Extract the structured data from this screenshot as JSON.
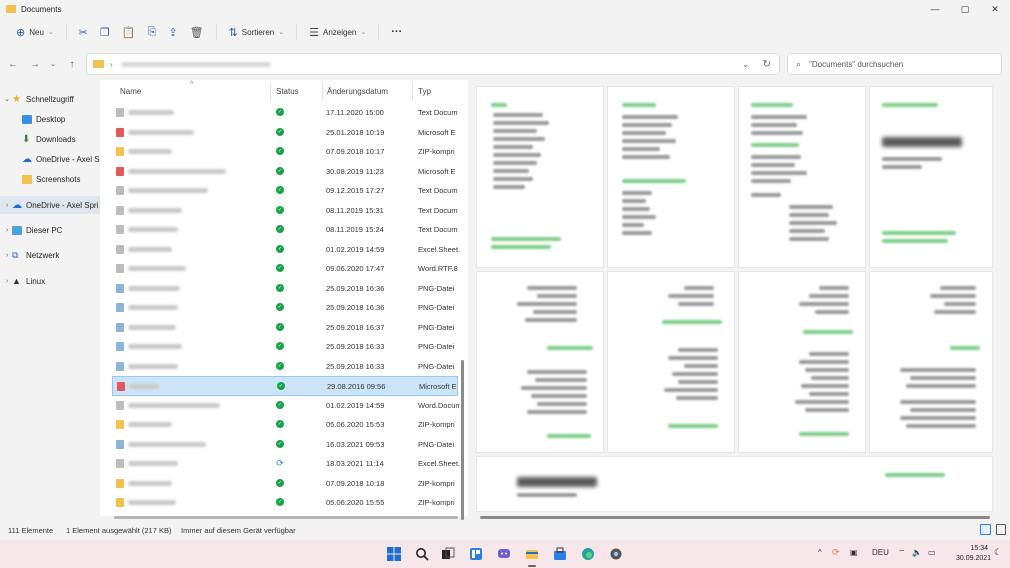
{
  "window": {
    "title": "Documents",
    "controls": {
      "minimize": "—",
      "maximize": "▢",
      "close": "✕"
    }
  },
  "toolbar": {
    "new_label": "Neu",
    "sort_label": "Sortieren",
    "view_label": "Anzeigen",
    "more_label": "···"
  },
  "address": {
    "search_placeholder": "\"Documents\" durchsuchen"
  },
  "nav": {
    "items": [
      {
        "label": "Schnellzugriff",
        "icon": "star-icon"
      },
      {
        "label": "Desktop",
        "icon": "desktop-icon"
      },
      {
        "label": "Downloads",
        "icon": "download-icon"
      },
      {
        "label": "OneDrive - Axel Sp",
        "icon": "onedrive-icon"
      },
      {
        "label": "Screenshots",
        "icon": "folder-icon"
      },
      {
        "label": "OneDrive - Axel Spri",
        "icon": "cloud-icon"
      },
      {
        "label": "Dieser PC",
        "icon": "pc-icon"
      },
      {
        "label": "Netzwerk",
        "icon": "network-icon"
      },
      {
        "label": "Linux",
        "icon": "linux-icon"
      }
    ]
  },
  "columns": {
    "name": "Name",
    "status": "Status",
    "date": "Änderungsdatum",
    "type": "Typ"
  },
  "files": [
    {
      "date": "17.11.2020 15:00",
      "type": "Text Docum",
      "status": "ok",
      "color": "#bdbdbd"
    },
    {
      "date": "25.01.2018 10:19",
      "type": "Microsoft E",
      "status": "ok",
      "color": "#e05a5a"
    },
    {
      "date": "07.09.2018 10:17",
      "type": "ZIP-kompri",
      "status": "ok",
      "color": "#f2c14e"
    },
    {
      "date": "30.08.2019 11:23",
      "type": "Microsoft E",
      "status": "ok",
      "color": "#e05a5a"
    },
    {
      "date": "09.12.2015 17:27",
      "type": "Text Docum",
      "status": "ok",
      "color": "#bdbdbd"
    },
    {
      "date": "08.11.2019 15:31",
      "type": "Text Docum",
      "status": "ok",
      "color": "#bdbdbd"
    },
    {
      "date": "08.11.2019 15:24",
      "type": "Text Docum",
      "status": "ok",
      "color": "#bdbdbd"
    },
    {
      "date": "01.02.2019 14:59",
      "type": "Excel.Sheet.",
      "status": "ok",
      "color": "#bdbdbd"
    },
    {
      "date": "09.06.2020 17:47",
      "type": "Word.RTF.8",
      "status": "ok",
      "color": "#bdbdbd"
    },
    {
      "date": "25.09.2018 16:36",
      "type": "PNG-Datei",
      "status": "ok",
      "color": "#8fb4d9"
    },
    {
      "date": "25.09.2018 16:36",
      "type": "PNG-Datei",
      "status": "ok",
      "color": "#8fb4d9"
    },
    {
      "date": "25.09.2018 16:37",
      "type": "PNG-Datei",
      "status": "ok",
      "color": "#8fb4d9"
    },
    {
      "date": "25.09.2018 16:33",
      "type": "PNG-Datei",
      "status": "ok",
      "color": "#8fb4d9"
    },
    {
      "date": "25.09.2018 16:33",
      "type": "PNG-Datei",
      "status": "ok",
      "color": "#8fb4d9"
    },
    {
      "date": "29.08.2016 09:56",
      "type": "Microsoft E",
      "status": "ok",
      "color": "#e05a5a"
    },
    {
      "date": "01.02.2019 14:59",
      "type": "Word.Docum",
      "status": "ok",
      "color": "#bdbdbd"
    },
    {
      "date": "05.06.2020 15:53",
      "type": "ZIP-kompri",
      "status": "ok",
      "color": "#f2c14e"
    },
    {
      "date": "16.03.2021 09:53",
      "type": "PNG-Datei",
      "status": "ok",
      "color": "#8fb4d9"
    },
    {
      "date": "18.03.2021 11:14",
      "type": "Excel.Sheet.",
      "status": "sync",
      "color": "#bdbdbd"
    },
    {
      "date": "07.09.2018 10:18",
      "type": "ZIP-kompri",
      "status": "ok",
      "color": "#f2c14e"
    },
    {
      "date": "05.06.2020 15:55",
      "type": "ZIP-kompri",
      "status": "ok",
      "color": "#f2c14e"
    }
  ],
  "selected_row": 14,
  "statusbar": {
    "count": "111 Elemente",
    "selection": "1 Element ausgewählt (217 KB)",
    "availability": "Immer auf diesem Gerät verfügbar"
  },
  "taskbar": {
    "lang": "DEU",
    "time": "15:34",
    "date": "30.09.2021"
  },
  "colors": {
    "accent": "#2b7de9",
    "selection": "#cce4f7",
    "status_ok": "#16a34a",
    "taskbar_bg": "#f7e6ea"
  }
}
